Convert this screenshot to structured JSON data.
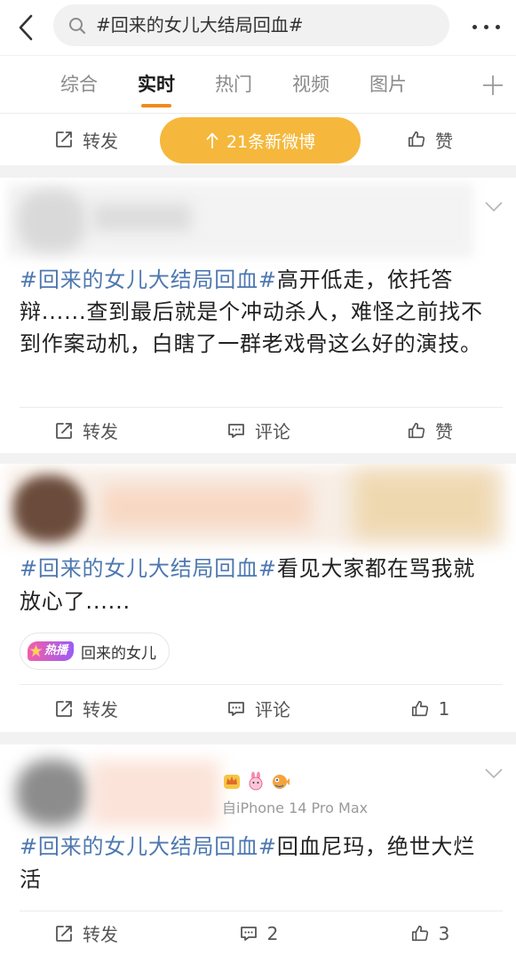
{
  "header": {
    "search_query": "#回来的女儿大结局回血#",
    "back_icon": "back-arrow-icon",
    "search_icon": "search-icon",
    "more_icon": "more-dots-icon"
  },
  "tabs": [
    {
      "label": "综合",
      "active": false
    },
    {
      "label": "实时",
      "active": true
    },
    {
      "label": "热门",
      "active": false
    },
    {
      "label": "视频",
      "active": false
    },
    {
      "label": "图片",
      "active": false
    }
  ],
  "top_action_bar": {
    "repost_label": "转发",
    "new_posts_label": "21条新微博",
    "like_label": "赞"
  },
  "posts": [
    {
      "hashtag": "#回来的女儿大结局回血#",
      "text": "高开低走，依托答辩......查到最后就是个冲动杀人，难怪之前找不到作案动机，白瞎了一群老戏骨这么好的演技。",
      "actions": {
        "repost": "转发",
        "comment": "评论",
        "like": "赞"
      }
    },
    {
      "hashtag": "#回来的女儿大结局回血#",
      "text": "看见大家都在骂我就放心了......",
      "topic_tag": {
        "badge": "热播",
        "label": "回来的女儿"
      },
      "actions": {
        "repost": "转发",
        "comment": "评论",
        "like": "1"
      }
    },
    {
      "hashtag": "#回来的女儿大结局回血#",
      "text": "回血尼玛，绝世大烂活",
      "badge_icons": [
        "crown-badge-icon",
        "bunny-icon",
        "pufferfish-icon"
      ],
      "source": "自iPhone 14 Pro Max",
      "actions": {
        "repost": "转发",
        "comment": "2",
        "like": "3"
      }
    }
  ],
  "colors": {
    "accent": "#f08a1d",
    "hashtag": "#4e78b0",
    "new_posts_pill": "#f5b83c",
    "separator": "#f2f2f2",
    "text": "#222222",
    "secondary": "#555555",
    "muted": "#8a8a8a"
  }
}
